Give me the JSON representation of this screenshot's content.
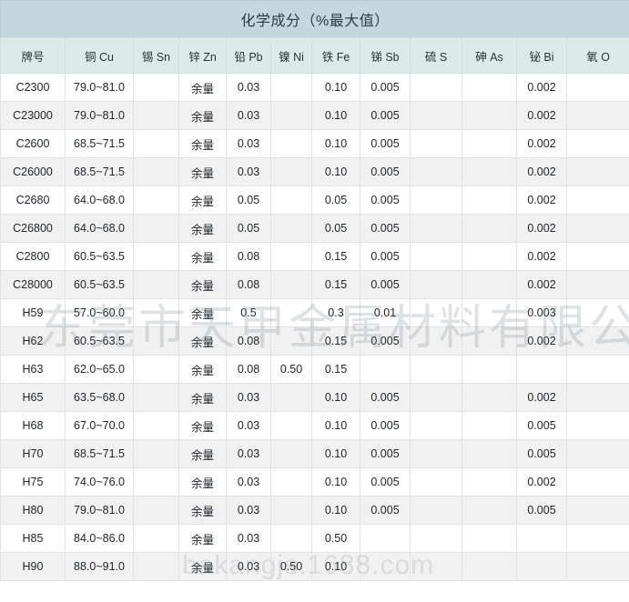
{
  "table": {
    "title": "化学成分（%最大值）",
    "columns": [
      "牌号",
      "铜 Cu",
      "锡 Sn",
      "锌 Zn",
      "铅 Pb",
      "镍 Ni",
      "铁 Fe",
      "锑 Sb",
      "硫 S",
      "砷 As",
      "铋 Bi",
      "氧 O"
    ],
    "rows": [
      {
        "cells": [
          "C2300",
          "79.0~81.0",
          "",
          "余量",
          "0.03",
          "",
          "0.10",
          "0.005",
          "",
          "",
          "0.002",
          ""
        ]
      },
      {
        "cells": [
          "C23000",
          "79.0~81.0",
          "",
          "余量",
          "0.03",
          "",
          "0.10",
          "0.005",
          "",
          "",
          "0.002",
          ""
        ]
      },
      {
        "cells": [
          "C2600",
          "68.5~71.5",
          "",
          "余量",
          "0.03",
          "",
          "0.10",
          "0.005",
          "",
          "",
          "0.002",
          ""
        ]
      },
      {
        "cells": [
          "C26000",
          "68.5~71.5",
          "",
          "余量",
          "0.03",
          "",
          "0.10",
          "0.005",
          "",
          "",
          "0.002",
          ""
        ]
      },
      {
        "cells": [
          "C2680",
          "64.0~68.0",
          "",
          "余量",
          "0.05",
          "",
          "0.05",
          "0.005",
          "",
          "",
          "0.002",
          ""
        ]
      },
      {
        "cells": [
          "C26800",
          "64.0~68.0",
          "",
          "余量",
          "0.05",
          "",
          "0.05",
          "0.005",
          "",
          "",
          "0.002",
          ""
        ]
      },
      {
        "cells": [
          "C2800",
          "60.5~63.5",
          "",
          "余量",
          "0.08",
          "",
          "0.15",
          "0.005",
          "",
          "",
          "0.002",
          ""
        ]
      },
      {
        "cells": [
          "C28000",
          "60.5~63.5",
          "",
          "余量",
          "0.08",
          "",
          "0.15",
          "0.005",
          "",
          "",
          "0.002",
          ""
        ]
      },
      {
        "cells": [
          "H59",
          "57.0~60.0",
          "",
          "余量",
          "0.5",
          "",
          "0.3",
          "0.01",
          "",
          "",
          "0.003",
          ""
        ]
      },
      {
        "cells": [
          "H62",
          "60.5~63.5",
          "",
          "余量",
          "0.08",
          "",
          "0.15",
          "0.005",
          "",
          "",
          "0.002",
          ""
        ]
      },
      {
        "cells": [
          "H63",
          "62.0~65.0",
          "",
          "余量",
          "0.08",
          "0.50",
          "0.15",
          "",
          "",
          "",
          "",
          ""
        ]
      },
      {
        "cells": [
          "H65",
          "63.5~68.0",
          "",
          "余量",
          "0.03",
          "",
          "0.10",
          "0.005",
          "",
          "",
          "0.002",
          ""
        ]
      },
      {
        "cells": [
          "H68",
          "67.0~70.0",
          "",
          "余量",
          "0.03",
          "",
          "0.10",
          "0.005",
          "",
          "",
          "0.005",
          ""
        ]
      },
      {
        "cells": [
          "H70",
          "68.5~71.5",
          "",
          "余量",
          "0.03",
          "",
          "0.10",
          "0.005",
          "",
          "",
          "0.005",
          ""
        ]
      },
      {
        "cells": [
          "H75",
          "74.0~76.0",
          "",
          "余量",
          "0.03",
          "",
          "0.10",
          "0.005",
          "",
          "",
          "0.002",
          ""
        ]
      },
      {
        "cells": [
          "H80",
          "79.0~81.0",
          "",
          "余量",
          "0.03",
          "",
          "0.10",
          "0.005",
          "",
          "",
          "0.005",
          ""
        ]
      },
      {
        "cells": [
          "H85",
          "84.0~86.0",
          "",
          "余量",
          "0.03",
          "",
          "0.50",
          "",
          "",
          "",
          "",
          ""
        ]
      },
      {
        "cells": [
          "H90",
          "88.0~91.0",
          "",
          "余量",
          "0.03",
          "0.50",
          "0.10",
          "",
          "",
          "",
          "",
          ""
        ]
      }
    ]
  },
  "watermarks": {
    "company": "东莞市天甲金属材料有限公司",
    "site": "bakangjs.1688.com"
  },
  "colors": {
    "title_bg": "#c4d6de",
    "header_bg": "#dcebe8",
    "row_alt_bg": "#f1f1f1",
    "border": "#e3e3e3"
  }
}
